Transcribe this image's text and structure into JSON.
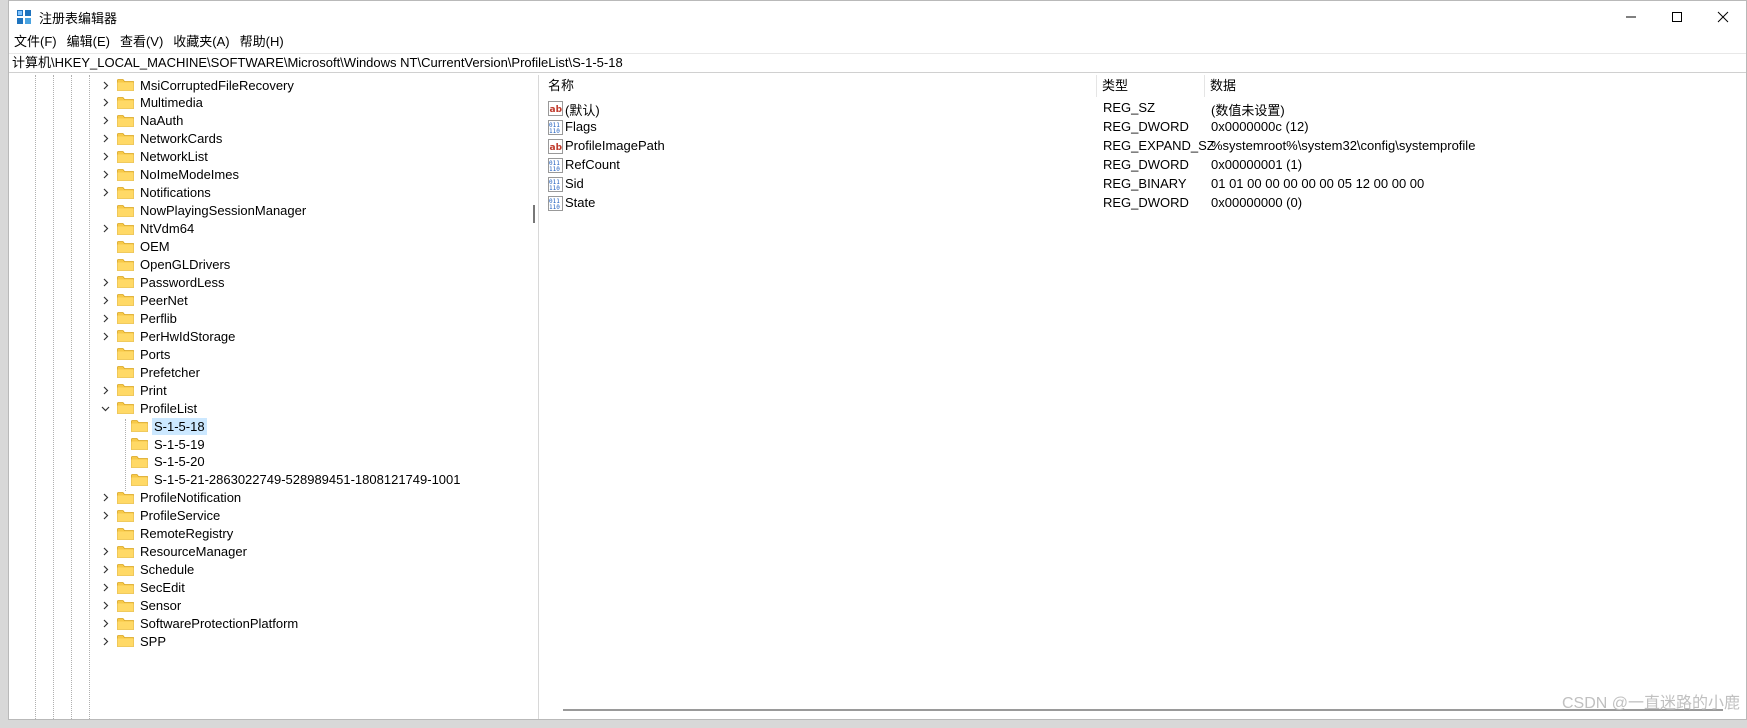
{
  "window": {
    "title": "注册表编辑器"
  },
  "menu": [
    "文件(F)",
    "编辑(E)",
    "查看(V)",
    "收藏夹(A)",
    "帮助(H)"
  ],
  "address": "计算机\\HKEY_LOCAL_MACHINE\\SOFTWARE\\Microsoft\\Windows NT\\CurrentVersion\\ProfileList\\S-1-5-18",
  "tree": [
    {
      "label": "MsiCorruptedFileRecovery",
      "expander": "collapsed",
      "level": 0
    },
    {
      "label": "Multimedia",
      "expander": "collapsed",
      "level": 0
    },
    {
      "label": "NaAuth",
      "expander": "collapsed",
      "level": 0
    },
    {
      "label": "NetworkCards",
      "expander": "collapsed",
      "level": 0
    },
    {
      "label": "NetworkList",
      "expander": "collapsed",
      "level": 0
    },
    {
      "label": "NoImeModeImes",
      "expander": "collapsed",
      "level": 0
    },
    {
      "label": "Notifications",
      "expander": "collapsed",
      "level": 0
    },
    {
      "label": "NowPlayingSessionManager",
      "expander": "none",
      "level": 0
    },
    {
      "label": "NtVdm64",
      "expander": "collapsed",
      "level": 0
    },
    {
      "label": "OEM",
      "expander": "none",
      "level": 0
    },
    {
      "label": "OpenGLDrivers",
      "expander": "none",
      "level": 0
    },
    {
      "label": "PasswordLess",
      "expander": "collapsed",
      "level": 0
    },
    {
      "label": "PeerNet",
      "expander": "collapsed",
      "level": 0
    },
    {
      "label": "Perflib",
      "expander": "collapsed",
      "level": 0
    },
    {
      "label": "PerHwIdStorage",
      "expander": "collapsed",
      "level": 0
    },
    {
      "label": "Ports",
      "expander": "none",
      "level": 0
    },
    {
      "label": "Prefetcher",
      "expander": "none",
      "level": 0
    },
    {
      "label": "Print",
      "expander": "collapsed",
      "level": 0
    },
    {
      "label": "ProfileList",
      "expander": "expanded",
      "level": 0
    },
    {
      "label": "S-1-5-18",
      "expander": "none",
      "level": 1,
      "selected": true
    },
    {
      "label": "S-1-5-19",
      "expander": "none",
      "level": 1
    },
    {
      "label": "S-1-5-20",
      "expander": "none",
      "level": 1
    },
    {
      "label": "S-1-5-21-2863022749-528989451-1808121749-1001",
      "expander": "none",
      "level": 1
    },
    {
      "label": "ProfileNotification",
      "expander": "collapsed",
      "level": 0
    },
    {
      "label": "ProfileService",
      "expander": "collapsed",
      "level": 0
    },
    {
      "label": "RemoteRegistry",
      "expander": "none",
      "level": 0
    },
    {
      "label": "ResourceManager",
      "expander": "collapsed",
      "level": 0
    },
    {
      "label": "Schedule",
      "expander": "collapsed",
      "level": 0
    },
    {
      "label": "SecEdit",
      "expander": "collapsed",
      "level": 0
    },
    {
      "label": "Sensor",
      "expander": "collapsed",
      "level": 0
    },
    {
      "label": "SoftwareProtectionPlatform",
      "expander": "collapsed",
      "level": 0
    },
    {
      "label": "SPP",
      "expander": "collapsed",
      "level": 0
    }
  ],
  "columns": {
    "name": "名称",
    "type": "类型",
    "data": "数据"
  },
  "values": [
    {
      "name": "(默认)",
      "type": "REG_SZ",
      "data": "(数值未设置)",
      "icon": "string-value-icon"
    },
    {
      "name": "Flags",
      "type": "REG_DWORD",
      "data": "0x0000000c (12)",
      "icon": "binary-value-icon"
    },
    {
      "name": "ProfileImagePath",
      "type": "REG_EXPAND_SZ",
      "data": "%systemroot%\\system32\\config\\systemprofile",
      "icon": "string-value-icon"
    },
    {
      "name": "RefCount",
      "type": "REG_DWORD",
      "data": "0x00000001 (1)",
      "icon": "binary-value-icon"
    },
    {
      "name": "Sid",
      "type": "REG_BINARY",
      "data": "01 01 00 00 00 00 00 05 12 00 00 00",
      "icon": "binary-value-icon"
    },
    {
      "name": "State",
      "type": "REG_DWORD",
      "data": "0x00000000 (0)",
      "icon": "binary-value-icon"
    }
  ],
  "watermark": "CSDN @一直迷路的小鹿",
  "colors": {
    "selection": "#cce8ff",
    "folder": "#f7c948"
  }
}
